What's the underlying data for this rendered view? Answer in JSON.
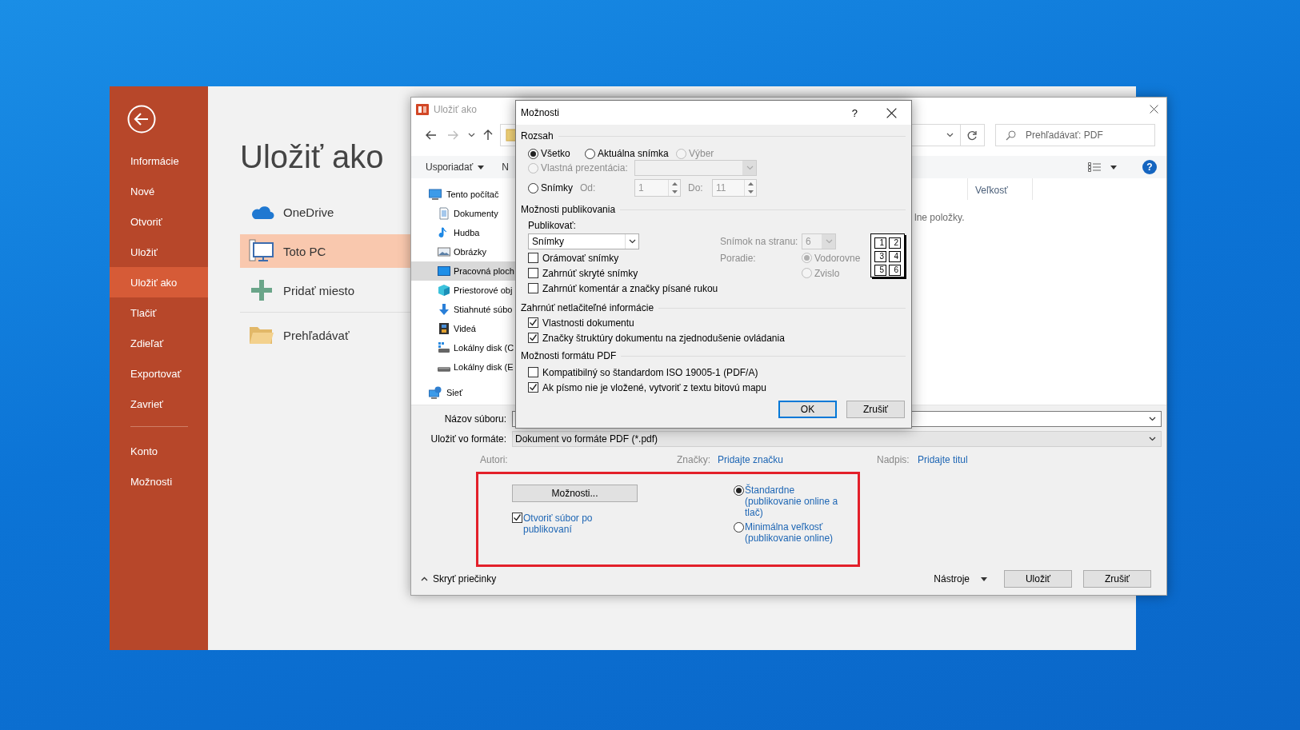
{
  "backstage": {
    "nav": [
      {
        "label": "Informácie",
        "selected": false
      },
      {
        "label": "Nové",
        "selected": false
      },
      {
        "label": "Otvoriť",
        "selected": false
      },
      {
        "label": "Uložiť",
        "selected": false
      },
      {
        "label": "Uložiť ako",
        "selected": true
      },
      {
        "label": "Tlačiť",
        "selected": false
      },
      {
        "label": "Zdieľať",
        "selected": false
      },
      {
        "label": "Exportovať",
        "selected": false
      },
      {
        "label": "Zavrieť",
        "selected": false
      }
    ],
    "nav_bottom": [
      {
        "label": "Konto",
        "selected": false
      },
      {
        "label": "Možnosti",
        "selected": false
      }
    ],
    "title": "Uložiť ako",
    "locations": [
      {
        "label": "OneDrive",
        "kind": "cloud",
        "selected": false
      },
      {
        "label": "Toto PC",
        "kind": "computer",
        "selected": true
      },
      {
        "label": "Pridať miesto",
        "kind": "add",
        "selected": false
      },
      {
        "label": "Prehľadávať",
        "kind": "folder",
        "selected": false
      }
    ]
  },
  "save_dialog": {
    "title": "Uložiť ako",
    "search": {
      "placeholder": "Prehľadávať: PDF"
    },
    "toolbar": [
      {
        "label": "Usporiadať",
        "kind": "menu"
      },
      {
        "label": "N",
        "kind": "plain"
      }
    ],
    "help_glyph": "?",
    "tree": [
      {
        "label": "Tento počítač",
        "kind": "computer",
        "selected": false,
        "children": [
          {
            "label": "Dokumenty",
            "kind": "documents",
            "selected": false
          },
          {
            "label": "Hudba",
            "kind": "music",
            "selected": false
          },
          {
            "label": "Obrázky",
            "kind": "pictures",
            "selected": false
          },
          {
            "label": "Pracovná ploch",
            "kind": "desktop",
            "selected": true
          },
          {
            "label": "Priestorové obj",
            "kind": "objects",
            "selected": false
          },
          {
            "label": "Stiahnuté súbo",
            "kind": "downloads",
            "selected": false
          },
          {
            "label": "Videá",
            "kind": "videos",
            "selected": false
          },
          {
            "label": "Lokálny disk (C",
            "kind": "system",
            "selected": false
          },
          {
            "label": "Lokálny disk (E",
            "kind": "disk",
            "selected": false
          }
        ]
      },
      {
        "label": "Sieť",
        "kind": "network",
        "selected": false
      }
    ],
    "column": "Veľkosť",
    "empty_message": "lne položky.",
    "file_name_label": "Názov súboru:",
    "format": {
      "label": "Uložiť vo formáte:",
      "value": "Dokument vo formáte PDF (*.pdf)"
    },
    "meta": [
      {
        "label": "Autori:"
      },
      {
        "label": "Značky:",
        "link": "Pridajte značku"
      },
      {
        "label": "Nadpis:",
        "link": "Pridajte titul"
      }
    ],
    "options_button": "Možnosti...",
    "open_after": {
      "label": "Otvoriť súbor po publikovaní",
      "checked": true
    },
    "optimize": [
      {
        "label": "Štandardne (publikovanie online a tlač)",
        "selected": true
      },
      {
        "label": "Minimálna veľkosť (publikovanie online)",
        "selected": false
      }
    ],
    "hide_folders": "Skryť priečinky",
    "tools": "Nástroje",
    "buttons": [
      "Uložiť",
      "Zrušiť"
    ]
  },
  "options": {
    "title": "Možnosti",
    "help_glyph": "?",
    "range": {
      "heading": "Rozsah",
      "choices": [
        {
          "label": "Všetko",
          "selected": true,
          "disabled": false
        },
        {
          "label": "Aktuálna snímka",
          "selected": false,
          "disabled": false
        },
        {
          "label": "Výber",
          "selected": false,
          "disabled": true
        },
        {
          "label": "Vlastná prezentácia:",
          "selected": false,
          "disabled": true
        },
        {
          "label": "Snímky",
          "selected": false,
          "disabled": false
        }
      ],
      "custom_show": {
        "disabled": true
      },
      "from": {
        "label": "Od:",
        "value": "1",
        "disabled": true
      },
      "to": {
        "label": "Do:",
        "value": "11",
        "disabled": true
      }
    },
    "publish": {
      "heading": "Možnosti publikovania",
      "label": "Publikovať:",
      "value": "Snímky",
      "per_page": {
        "label": "Snímok na stranu:",
        "value": "6",
        "disabled": true
      },
      "order_label": "Poradie:",
      "order": [
        {
          "label": "Vodorovne",
          "selected": true,
          "disabled": true
        },
        {
          "label": "Zvislo",
          "selected": false,
          "disabled": true
        }
      ],
      "preview": [
        "1",
        "2",
        "3",
        "4",
        "5",
        "6"
      ],
      "checks": [
        {
          "label": "Orámovať snímky",
          "checked": false
        },
        {
          "label": "Zahrnúť skryté snímky",
          "checked": false
        },
        {
          "label": "Zahrnúť komentár a značky písané rukou",
          "checked": false
        }
      ]
    },
    "nonprinting": {
      "heading": "Zahrnúť netlačiteľné informácie",
      "checks": [
        {
          "label": "Vlastnosti dokumentu",
          "checked": true
        },
        {
          "label": "Značky štruktúry dokumentu na zjednodušenie ovládania",
          "checked": true
        }
      ]
    },
    "pdf": {
      "heading": "Možnosti formátu PDF",
      "checks": [
        {
          "label": "Kompatibilný so štandardom ISO 19005-1 (PDF/A)",
          "checked": false
        },
        {
          "label": "Ak písmo nie je vložené, vytvoriť z textu bitovú mapu",
          "checked": true
        }
      ]
    },
    "buttons": [
      {
        "label": "OK",
        "default": true
      },
      {
        "label": "Zrušiť",
        "default": false
      }
    ]
  }
}
